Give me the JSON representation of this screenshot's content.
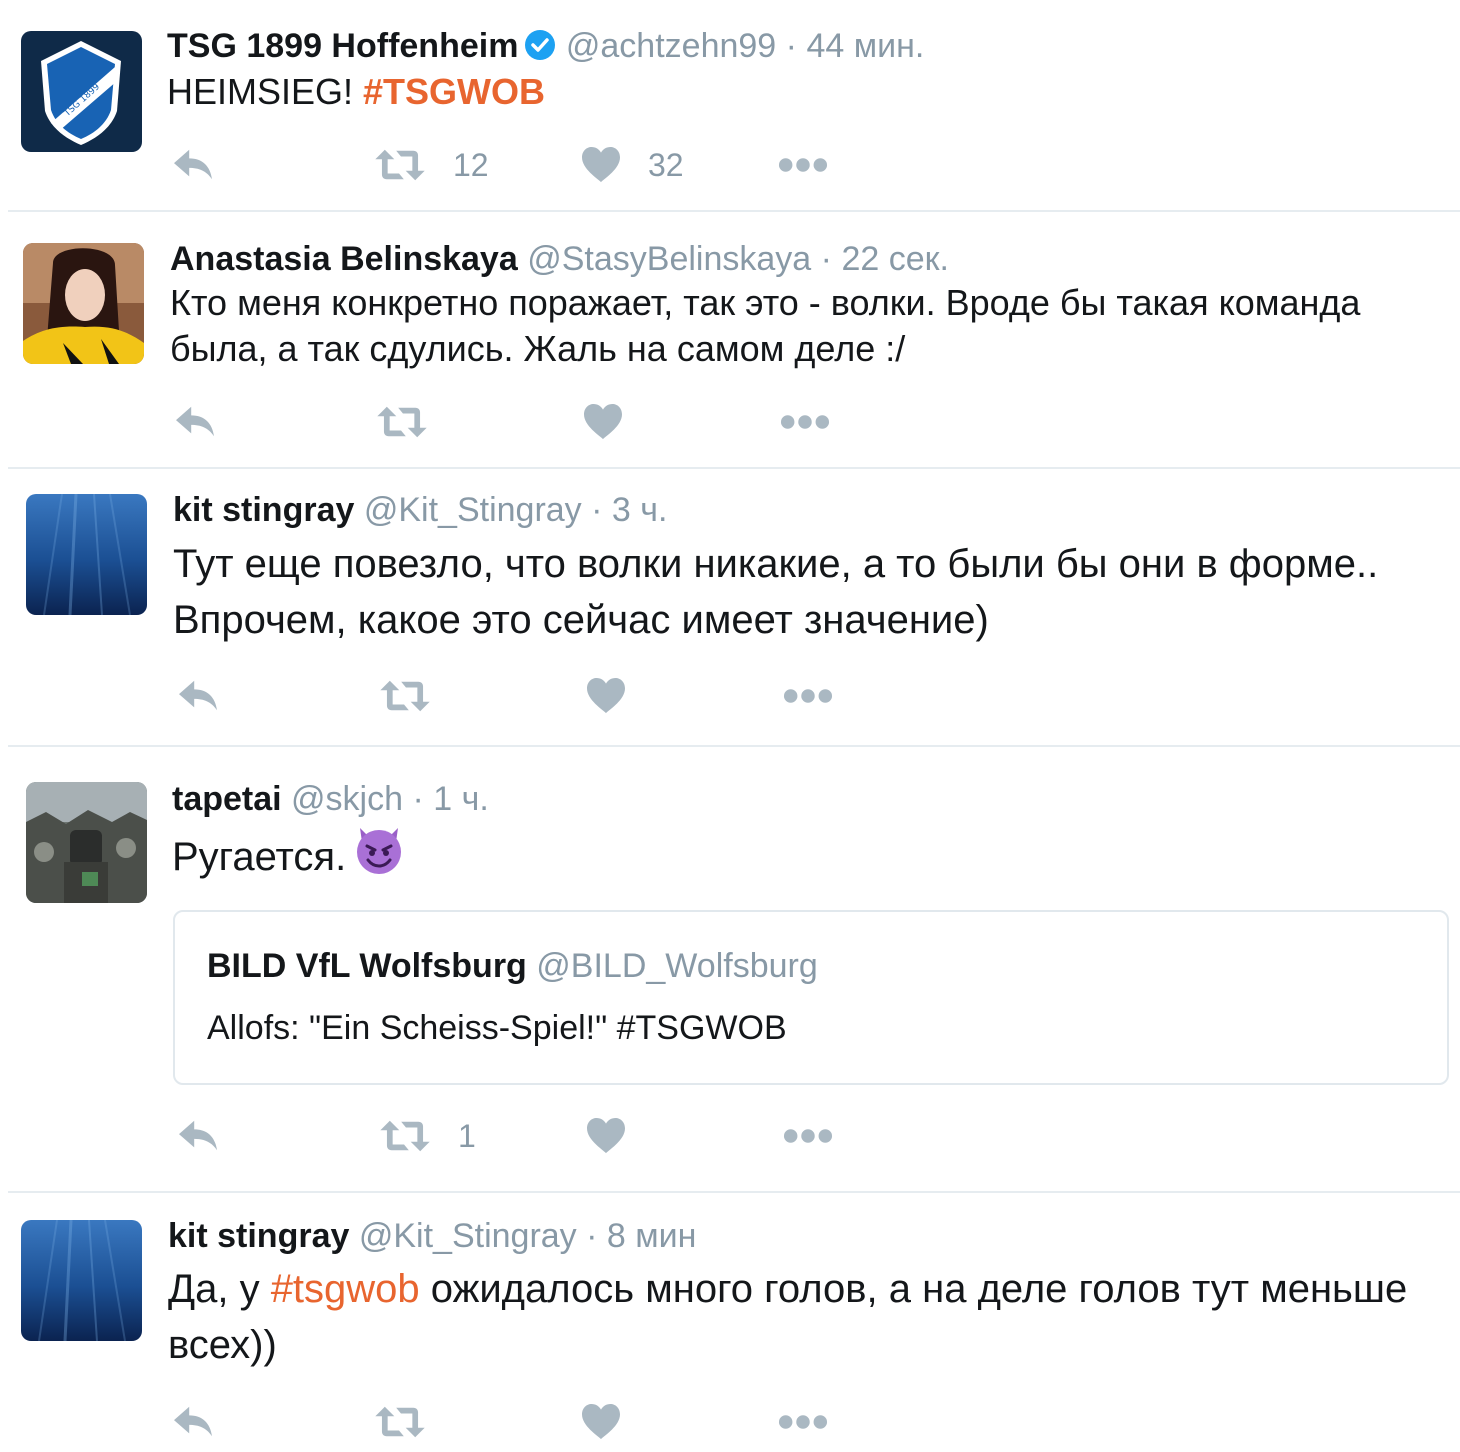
{
  "colors": {
    "hashtag": "#e8652f",
    "muted": "#8899a6",
    "icon": "#aab8c2",
    "verified": "#1da1f2",
    "divider": "#e6ecf0"
  },
  "tweets": [
    {
      "name": "TSG 1899 Hoffenheim",
      "verified": true,
      "screen_name": "@achtzehn99",
      "separator": "·",
      "time": "44 мин.",
      "text_before": "HEIMSIEG! ",
      "hashtag": "#TSGWOB",
      "retweets": "12",
      "likes": "32",
      "avatar_icon": "hoffenheim-crest-icon"
    },
    {
      "name": "Anastasia Belinskaya",
      "screen_name": "@StasyBelinskaya",
      "separator": "·",
      "time": "22 сек.",
      "text_line1": "Кто меня конкретно поражает, так это - волки. Вроде бы такая команда",
      "text_line2": "была, а так сдулись. Жаль на самом деле :/",
      "avatar_icon": "user-photo-icon"
    },
    {
      "name": "kit stingray",
      "screen_name": "@Kit_Stingray",
      "separator": "·",
      "time": "3 ч.",
      "text_line1": "Тут еще повезло, что волки никакие, а то были бы они в форме..",
      "text_line2": "Впрочем, какое это сейчас имеет значение)",
      "avatar_icon": "underwater-icon"
    },
    {
      "name": "tapetai",
      "screen_name": "@skjch",
      "separator": "·",
      "time": "1 ч.",
      "text": "Ругается.",
      "emoji": "smiling-imp-emoji",
      "retweets": "1",
      "avatar_icon": "crowd-photo-icon",
      "quote": {
        "name": "BILD VfL Wolfsburg",
        "screen_name": "@BILD_Wolfsburg",
        "text": "Allofs: \"Ein Scheiss-Spiel!\" #TSGWOB"
      }
    },
    {
      "name": "kit stingray",
      "screen_name": "@Kit_Stingray",
      "separator": "·",
      "time": "8 мин",
      "text_before": "Да, у ",
      "hashtag": "#tsgwob",
      "text_after": " ожидалось много голов, а на деле голов тут меньше",
      "text_line2": "всех))",
      "avatar_icon": "underwater-icon"
    }
  ],
  "icons": {
    "reply": "reply-icon",
    "retweet": "retweet-icon",
    "like": "heart-icon",
    "more": "more-icon",
    "verified": "verified-badge-icon"
  }
}
